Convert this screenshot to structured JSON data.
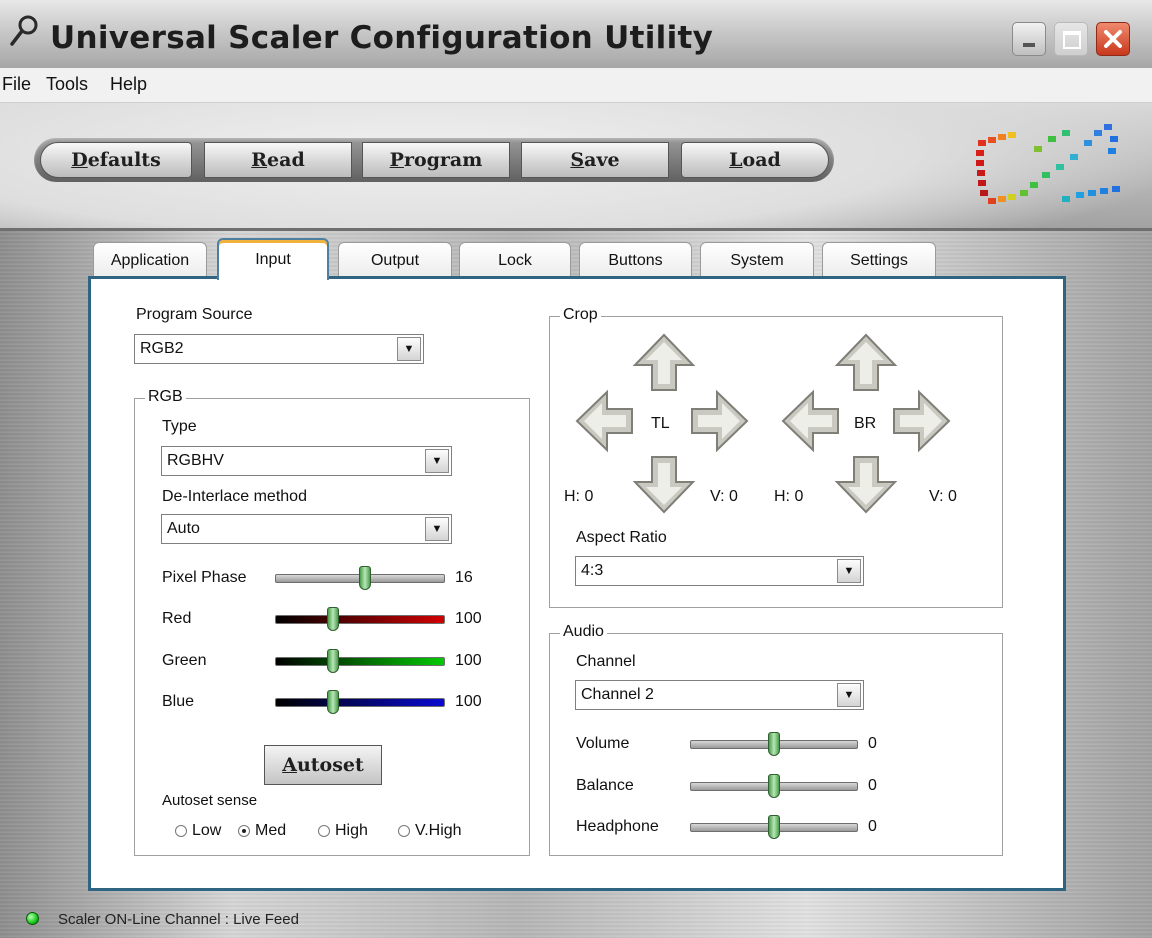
{
  "window": {
    "title": "Universal Scaler Configuration Utility"
  },
  "menu": [
    "File",
    "Tools",
    "Help"
  ],
  "toolbar": {
    "buttons": [
      {
        "label": "Defaults",
        "mnemonic": "D"
      },
      {
        "label": "Read",
        "mnemonic": "R"
      },
      {
        "label": "Program",
        "mnemonic": "P"
      },
      {
        "label": "Save",
        "mnemonic": "S"
      },
      {
        "label": "Load",
        "mnemonic": "L"
      }
    ]
  },
  "tabs": [
    "Application",
    "Input",
    "Output",
    "Lock",
    "Buttons",
    "System",
    "Settings"
  ],
  "active_tab": "Input",
  "input": {
    "program_source_label": "Program Source",
    "program_source_value": "RGB2",
    "rgb_group": "RGB",
    "type_label": "Type",
    "type_value": "RGBHV",
    "deinterlace_label": "De-Interlace method",
    "deinterlace_value": "Auto",
    "sliders": [
      {
        "label": "Pixel Phase",
        "value": "16",
        "level": 0.53
      },
      {
        "label": "Red",
        "value": "100",
        "level": 0.34
      },
      {
        "label": "Green",
        "value": "100",
        "level": 0.34
      },
      {
        "label": "Blue",
        "value": "100",
        "level": 0.34
      }
    ],
    "autoset_label": "Autoset",
    "autoset_mnemonic": "A",
    "autoset_sense_label": "Autoset sense",
    "autoset_sense_options": [
      "Low",
      "Med",
      "High",
      "V.High"
    ],
    "autoset_sense_selected": "Med"
  },
  "crop": {
    "group": "Crop",
    "tl_label": "TL",
    "br_label": "BR",
    "tl_h": "H: 0",
    "tl_v": "V: 0",
    "br_h": "H: 0",
    "br_v": "V: 0",
    "aspect_label": "Aspect Ratio",
    "aspect_value": "4:3"
  },
  "audio": {
    "group": "Audio",
    "channel_label": "Channel",
    "channel_value": "Channel 2",
    "sliders": [
      {
        "label": "Volume",
        "value": "0",
        "level": 0.5
      },
      {
        "label": "Balance",
        "value": "0",
        "level": 0.5
      },
      {
        "label": "Headphone",
        "value": "0",
        "level": 0.5
      }
    ]
  },
  "status": {
    "text": "Scaler ON-Line Channel : Live Feed",
    "led_color": "#18c818"
  },
  "colors": {
    "panel_border": "#2f6583",
    "active_tab_accent": "#f2b13a",
    "close_button": "#c8381c"
  }
}
